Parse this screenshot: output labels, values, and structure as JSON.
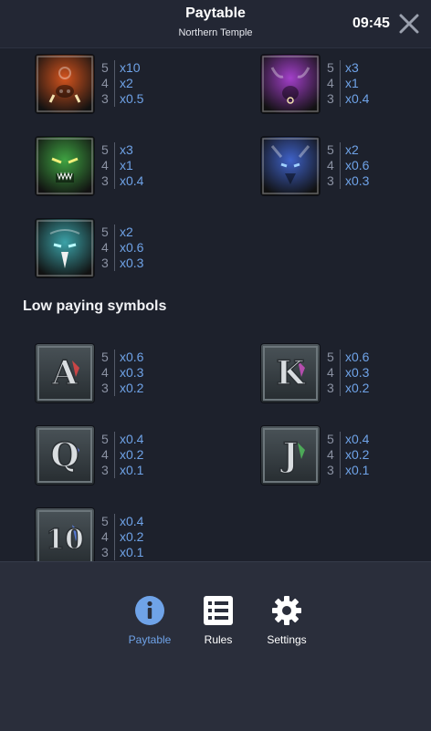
{
  "header": {
    "title": "Paytable",
    "subtitle": "Northern Temple",
    "clock": "09:45"
  },
  "high_symbols": [
    {
      "name": "boar",
      "color": "#d4541e",
      "pays": [
        {
          "count": "5",
          "mult": "x10"
        },
        {
          "count": "4",
          "mult": "x2"
        },
        {
          "count": "3",
          "mult": "x0.5"
        }
      ]
    },
    {
      "name": "bull",
      "color": "#a23fc9",
      "pays": [
        {
          "count": "5",
          "mult": "x3"
        },
        {
          "count": "4",
          "mult": "x1"
        },
        {
          "count": "3",
          "mult": "x0.4"
        }
      ]
    },
    {
      "name": "dragon",
      "color": "#3fa342",
      "pays": [
        {
          "count": "5",
          "mult": "x3"
        },
        {
          "count": "4",
          "mult": "x1"
        },
        {
          "count": "3",
          "mult": "x0.4"
        }
      ]
    },
    {
      "name": "wolf",
      "color": "#3f62c9",
      "pays": [
        {
          "count": "5",
          "mult": "x2"
        },
        {
          "count": "4",
          "mult": "x0.6"
        },
        {
          "count": "3",
          "mult": "x0.3"
        }
      ]
    },
    {
      "name": "eagle",
      "color": "#3ba2a8",
      "pays": [
        {
          "count": "5",
          "mult": "x2"
        },
        {
          "count": "4",
          "mult": "x0.6"
        },
        {
          "count": "3",
          "mult": "x0.3"
        }
      ]
    }
  ],
  "low_heading": "Low paying symbols",
  "low_symbols": [
    {
      "letter": "A",
      "accent": "#d94646",
      "pays": [
        {
          "count": "5",
          "mult": "x0.6"
        },
        {
          "count": "4",
          "mult": "x0.3"
        },
        {
          "count": "3",
          "mult": "x0.2"
        }
      ]
    },
    {
      "letter": "K",
      "accent": "#c24fb8",
      "pays": [
        {
          "count": "5",
          "mult": "x0.6"
        },
        {
          "count": "4",
          "mult": "x0.3"
        },
        {
          "count": "3",
          "mult": "x0.2"
        }
      ]
    },
    {
      "letter": "Q",
      "accent": "#6a7de0",
      "pays": [
        {
          "count": "5",
          "mult": "x0.4"
        },
        {
          "count": "4",
          "mult": "x0.2"
        },
        {
          "count": "3",
          "mult": "x0.1"
        }
      ]
    },
    {
      "letter": "J",
      "accent": "#4fb45a",
      "pays": [
        {
          "count": "5",
          "mult": "x0.4"
        },
        {
          "count": "4",
          "mult": "x0.2"
        },
        {
          "count": "3",
          "mult": "x0.1"
        }
      ]
    },
    {
      "letter": "10",
      "accent": "#5a7ee0",
      "pays": [
        {
          "count": "5",
          "mult": "x0.4"
        },
        {
          "count": "4",
          "mult": "x0.2"
        },
        {
          "count": "3",
          "mult": "x0.1"
        }
      ]
    }
  ],
  "nav": [
    {
      "label": "Paytable",
      "icon": "info-icon",
      "active": true
    },
    {
      "label": "Rules",
      "icon": "list-icon",
      "active": false
    },
    {
      "label": "Settings",
      "icon": "gear-icon",
      "active": false
    }
  ],
  "colors": {
    "background": "#1d212c",
    "accent": "#6fa3e8",
    "count_text": "#8b92a3"
  }
}
